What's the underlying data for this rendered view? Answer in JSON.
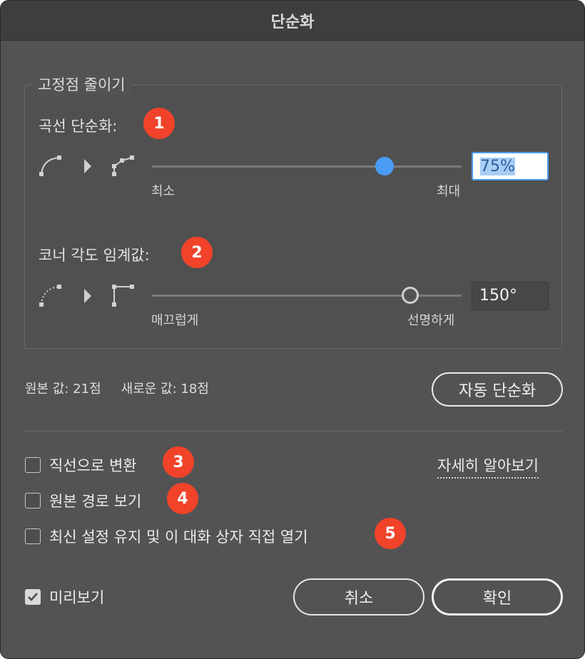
{
  "dialog": {
    "title": "단순화"
  },
  "reduce_anchors": {
    "legend": "고정점 줄이기",
    "curve_simplify": {
      "label": "곡선 단순화:",
      "badge": "1",
      "min_label": "최소",
      "max_label": "최대",
      "value_display": "75%",
      "level_fraction": 0.75
    },
    "corner_threshold": {
      "label": "코너 각도 임계값:",
      "badge": "2",
      "min_label": "매끄럽게",
      "max_label": "선명하게",
      "value_display": "150°",
      "value": 150
    }
  },
  "counts": {
    "original": "원본 값: 21점",
    "new": "새로운 값: 18점"
  },
  "auto_simplify_label": "자동 단순화",
  "options": {
    "convert_to_lines": {
      "label": "직선으로 변환",
      "badge": "3",
      "checked": false
    },
    "show_original": {
      "label": "원본 경로 보기",
      "badge": "4",
      "checked": false
    },
    "keep_latest": {
      "label": "최신 설정 유지 및 이 대화 상자 직접 열기",
      "badge": "5",
      "checked": false
    },
    "learn_more": "자세히 알아보기"
  },
  "footer": {
    "preview": {
      "label": "미리보기",
      "checked": true
    },
    "cancel_label": "취소",
    "ok_label": "확인"
  },
  "colors": {
    "accent": "#4a9cf4",
    "badge": "#f0432a",
    "background": "#535353"
  }
}
